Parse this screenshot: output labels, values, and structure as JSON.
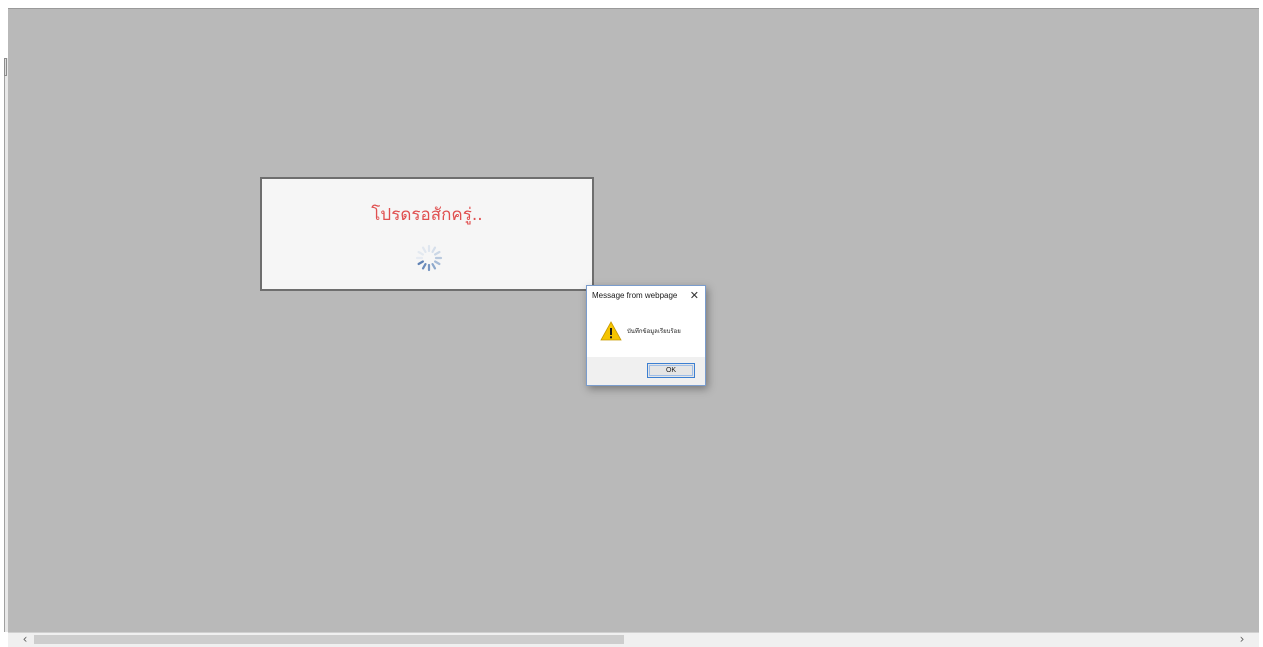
{
  "loading": {
    "message": "โปรดรอสักครู่..",
    "spinner_icon": "spinner-icon"
  },
  "dialog": {
    "title": "Message from webpage",
    "close_glyph": "✕",
    "message": "บันทึกข้อมูลเรียบร้อย",
    "icon": "warning-icon",
    "ok_label": "OK"
  },
  "scrollbar": {
    "left_glyph": "‹",
    "right_glyph": "›"
  },
  "colors": {
    "overlay": "#b9b9b9",
    "loading_text": "#e05050",
    "ok_border": "#3c7fd1",
    "warning": "#f5c400"
  }
}
